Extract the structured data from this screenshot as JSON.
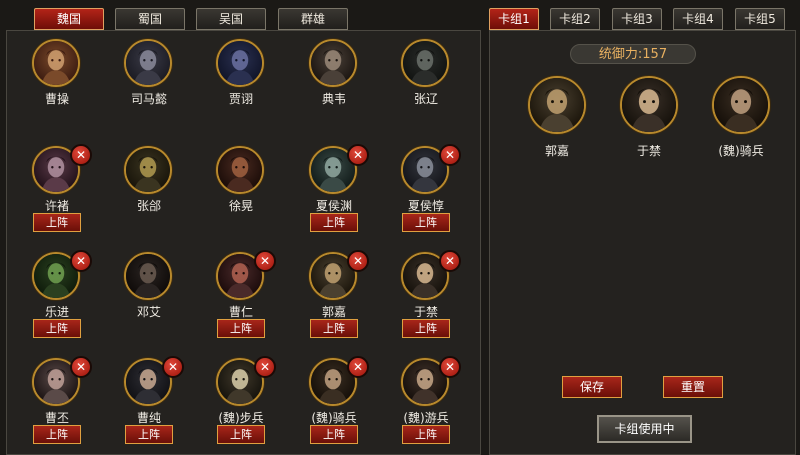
{
  "faction_tabs": [
    {
      "label": "魏国",
      "active": true
    },
    {
      "label": "蜀国",
      "active": false
    },
    {
      "label": "吴国",
      "active": false
    },
    {
      "label": "群雄",
      "active": false
    }
  ],
  "deck_tabs": [
    {
      "label": "卡组1",
      "active": true
    },
    {
      "label": "卡组2",
      "active": false
    },
    {
      "label": "卡组3",
      "active": false
    },
    {
      "label": "卡组4",
      "active": false
    },
    {
      "label": "卡组5",
      "active": false
    }
  ],
  "remove_icon": "✕",
  "heroes": [
    {
      "name": "曹操",
      "removable": false,
      "deploy_label": ""
    },
    {
      "name": "司马懿",
      "removable": false,
      "deploy_label": ""
    },
    {
      "name": "贾诩",
      "removable": false,
      "deploy_label": ""
    },
    {
      "name": "典韦",
      "removable": false,
      "deploy_label": ""
    },
    {
      "name": "张辽",
      "removable": false,
      "deploy_label": ""
    },
    {
      "name": "许褚",
      "removable": true,
      "deploy_label": "上阵"
    },
    {
      "name": "张郃",
      "removable": false,
      "deploy_label": ""
    },
    {
      "name": "徐晃",
      "removable": false,
      "deploy_label": ""
    },
    {
      "name": "夏侯渊",
      "removable": true,
      "deploy_label": "上阵"
    },
    {
      "name": "夏侯惇",
      "removable": true,
      "deploy_label": "上阵"
    },
    {
      "name": "乐进",
      "removable": true,
      "deploy_label": "上阵"
    },
    {
      "name": "邓艾",
      "removable": false,
      "deploy_label": ""
    },
    {
      "name": "曹仁",
      "removable": true,
      "deploy_label": "上阵"
    },
    {
      "name": "郭嘉",
      "removable": true,
      "deploy_label": "上阵"
    },
    {
      "name": "于禁",
      "removable": true,
      "deploy_label": "上阵"
    },
    {
      "name": "曹丕",
      "removable": true,
      "deploy_label": "上阵"
    },
    {
      "name": "曹纯",
      "removable": true,
      "deploy_label": "上阵"
    },
    {
      "name": "(魏)步兵",
      "removable": true,
      "deploy_label": "上阵"
    },
    {
      "name": "(魏)骑兵",
      "removable": true,
      "deploy_label": "上阵"
    },
    {
      "name": "(魏)游兵",
      "removable": true,
      "deploy_label": "上阵"
    }
  ],
  "command": {
    "label": "统御力:157"
  },
  "deck_cards": [
    {
      "name": "郭嘉"
    },
    {
      "name": "于禁"
    },
    {
      "name": "(魏)骑兵"
    }
  ],
  "actions": {
    "save": "保存",
    "reset": "重置",
    "in_use": "卡组使用中"
  },
  "colors": {
    "accent_red": "#a8261a",
    "gold": "#b8892c",
    "panel": "#24221f"
  }
}
